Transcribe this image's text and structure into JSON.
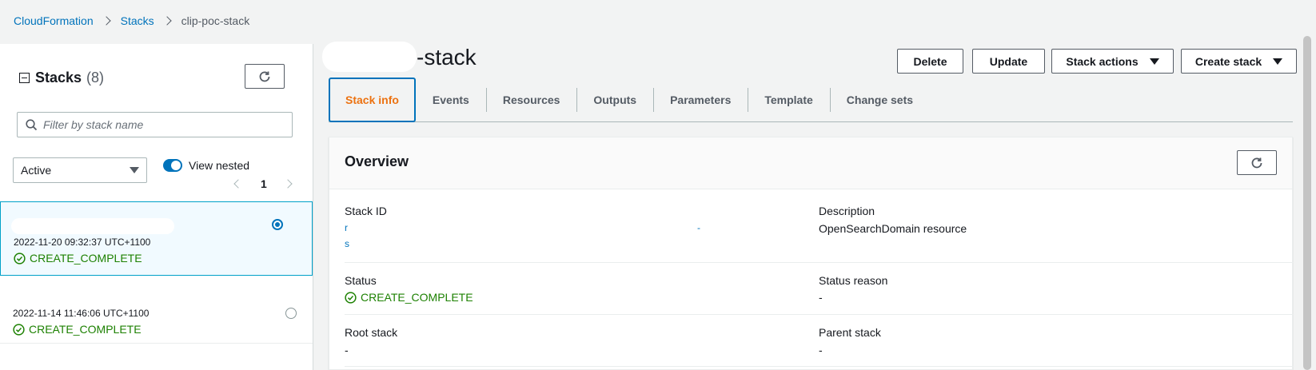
{
  "breadcrumb": {
    "items": [
      "CloudFormation",
      "Stacks"
    ],
    "current": "clip-poc-stack"
  },
  "sidebar": {
    "title": "Stacks",
    "count": "(8)",
    "search_placeholder": "Filter by stack name",
    "filter_value": "Active",
    "toggle_label": "View nested",
    "page": "1",
    "stacks": [
      {
        "date": "2022-11-20 09:32:37 UTC+1100",
        "status": "CREATE_COMPLETE",
        "selected": true
      },
      {
        "date": "2022-11-14 11:46:06 UTC+1100",
        "status": "CREATE_COMPLETE",
        "selected": false
      }
    ]
  },
  "main": {
    "title_suffix": "-stack",
    "buttons": {
      "delete": "Delete",
      "update": "Update",
      "stack_actions": "Stack actions",
      "create_stack": "Create stack"
    },
    "tabs": [
      {
        "label": "Stack info",
        "active": true
      },
      {
        "label": "Events"
      },
      {
        "label": "Resources"
      },
      {
        "label": "Outputs"
      },
      {
        "label": "Parameters"
      },
      {
        "label": "Template"
      },
      {
        "label": "Change sets"
      }
    ],
    "overview": {
      "title": "Overview",
      "stack_id_label": "Stack ID",
      "stack_id_fragments": [
        "r",
        "-",
        "s"
      ],
      "description_label": "Description",
      "description_value": "OpenSearchDomain resource",
      "status_label": "Status",
      "status_value": "CREATE_COMPLETE",
      "status_reason_label": "Status reason",
      "status_reason_value": "-",
      "root_stack_label": "Root stack",
      "root_stack_value": "-",
      "parent_stack_label": "Parent stack",
      "parent_stack_value": "-"
    }
  },
  "colors": {
    "link": "#0073bb",
    "success": "#1d8102",
    "active_tab": "#ec7211",
    "selected_bg": "#f1faff"
  }
}
